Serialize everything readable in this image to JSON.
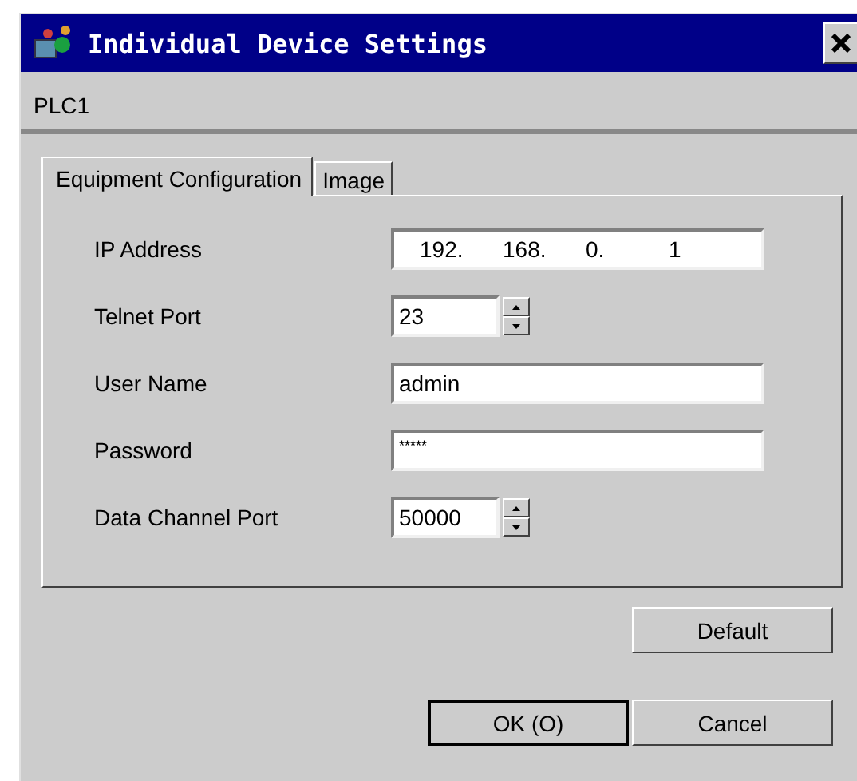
{
  "window": {
    "title": "Individual Device Settings"
  },
  "device_name": "PLC1",
  "tabs": [
    {
      "label": "Equipment Configuration",
      "selected": true
    },
    {
      "label": "Image",
      "selected": false
    }
  ],
  "fields": [
    {
      "kind": "ip",
      "label": "IP Address",
      "value": [
        "192.",
        "168.",
        "0.",
        "1"
      ]
    },
    {
      "kind": "spin",
      "label": "Telnet Port",
      "value": "23"
    },
    {
      "kind": "text",
      "label": "User Name",
      "value": "admin"
    },
    {
      "kind": "password",
      "label": "Password",
      "value": "*****"
    },
    {
      "kind": "spin",
      "label": "Data Channel Port",
      "value": "50000"
    }
  ],
  "default_button": "Default",
  "buttons": [
    {
      "label": "OK (O)",
      "default": true
    },
    {
      "label": "Cancel",
      "default": false
    }
  ]
}
